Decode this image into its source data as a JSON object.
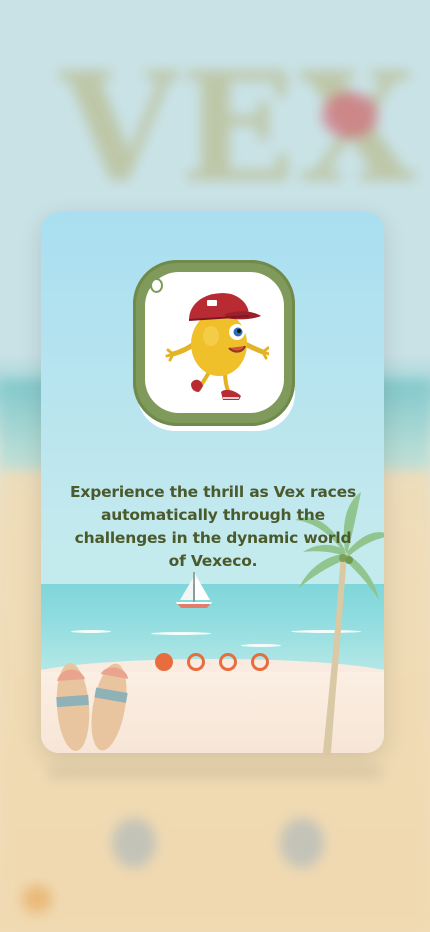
{
  "background": {
    "title": "VEX"
  },
  "onboarding": {
    "description": "Experience the thrill as Vex races automatically through the challenges in the dynamic world of Vexeco.",
    "page_count": 4,
    "active_page": 1
  },
  "icons": {
    "logo": "vex-character-icon",
    "boat": "sailboat-icon",
    "palm": "palm-tree-icon",
    "surfboards": "surfboards-icon"
  },
  "colors": {
    "accent": "#e86d3e",
    "text": "#4b5a2c",
    "logo_frame": "#7f9a5a",
    "sky": "#a9dff0",
    "sea": "#7fd6da",
    "sand": "#f7e6d7"
  }
}
